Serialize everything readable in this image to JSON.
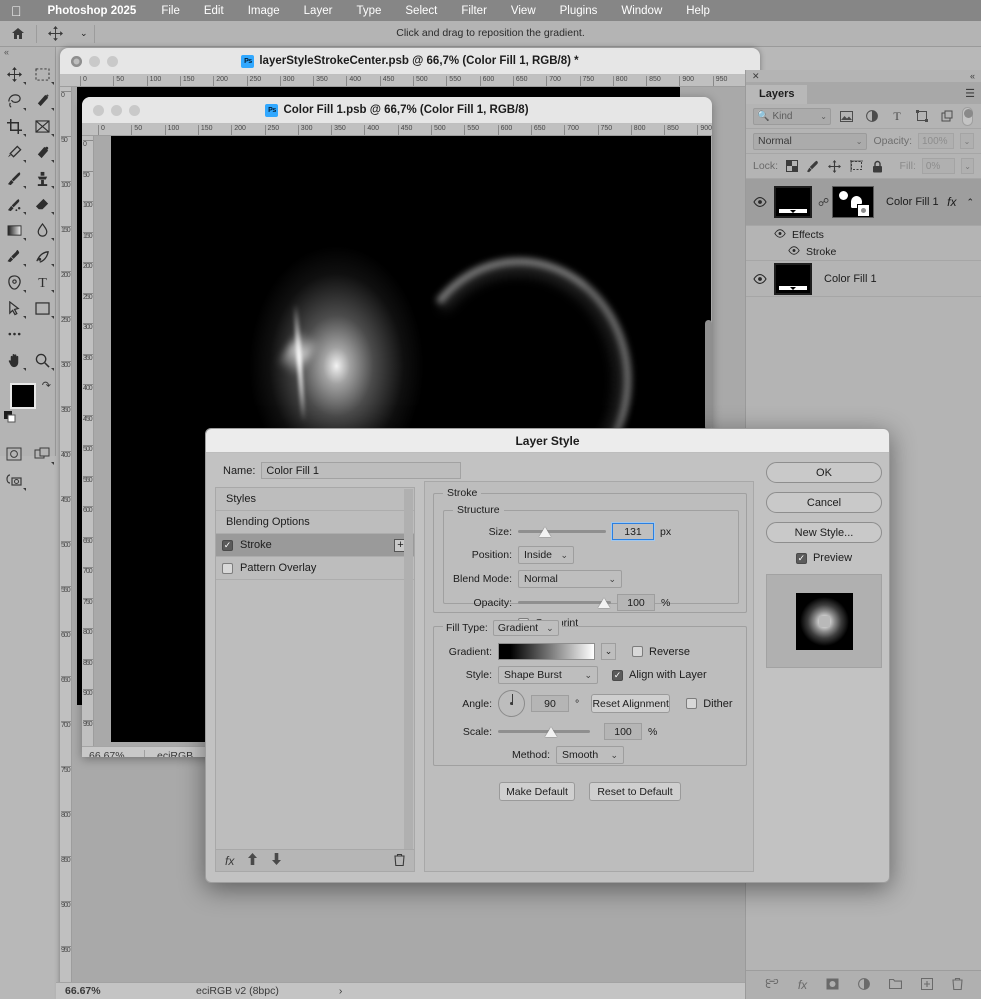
{
  "menubar": {
    "apple_icon": "apple-icon",
    "app_name": "Photoshop 2025",
    "items": [
      "File",
      "Edit",
      "Image",
      "Layer",
      "Type",
      "Select",
      "Filter",
      "View",
      "Plugins",
      "Window",
      "Help"
    ]
  },
  "options_bar": {
    "home_icon": "home-icon",
    "tool_icon": "move-tool-icon",
    "chevron": "⌄",
    "hint": "Click and drag to reposition the gradient."
  },
  "toolbar": {
    "collapse_icon": "collapse-panel-icon",
    "tools": [
      {
        "name": "move-tool"
      },
      {
        "name": "rectangular-marquee-tool"
      },
      {
        "name": "lasso-tool"
      },
      {
        "name": "magic-wand-tool"
      },
      {
        "name": "crop-tool"
      },
      {
        "name": "frame-tool"
      },
      {
        "name": "eyedropper-tool"
      },
      {
        "name": "spot-healing-brush-tool"
      },
      {
        "name": "brush-tool"
      },
      {
        "name": "clone-stamp-tool"
      },
      {
        "name": "history-brush-tool"
      },
      {
        "name": "eraser-tool"
      },
      {
        "name": "gradient-tool"
      },
      {
        "name": "blur-tool"
      },
      {
        "name": "dodge-tool"
      },
      {
        "name": "pen-tool-curvature"
      },
      {
        "name": "pen-tool"
      },
      {
        "name": "type-tool"
      },
      {
        "name": "path-selection-tool"
      },
      {
        "name": "rectangle-tool"
      },
      {
        "name": "more-tools"
      },
      {
        "name": "hand-tool"
      },
      {
        "name": "zoom-tool"
      }
    ],
    "foreground_color": "#000000",
    "background_color": "#ffffff",
    "swap_icon": "swap-colors-icon",
    "default_icon": "default-colors-icon",
    "quickmask_icon": "quick-mask-icon",
    "screenmode_icon": "screen-mode-icon",
    "camera_icon": "share-camera-icon"
  },
  "background_window": {
    "title": "layerStyleStrokeCenter.psb @ 66,7% (Color Fill 1, RGB/8) *",
    "ps_badge": "Ps",
    "traffic_lights": [
      "close",
      "minimize",
      "zoom"
    ]
  },
  "document_window": {
    "title": "Color Fill 1.psb @ 66,7% (Color Fill 1, RGB/8)",
    "ps_badge": "Ps",
    "ruler_h_ticks": [
      "0",
      "50",
      "100",
      "150",
      "200",
      "250",
      "300",
      "350",
      "400",
      "450",
      "500",
      "550",
      "600",
      "650",
      "700",
      "750",
      "800",
      "850",
      "900",
      "950",
      "100"
    ],
    "ruler_v_ticks": [
      "0",
      "50",
      "100",
      "150",
      "200",
      "250",
      "300",
      "350",
      "400",
      "450",
      "500",
      "550",
      "600",
      "650",
      "700",
      "750",
      "800",
      "850",
      "900",
      "950",
      "10"
    ],
    "status": {
      "zoom": "66.67%",
      "profile": "eciRGB"
    }
  },
  "app_status": {
    "zoom": "66.67%",
    "profile": "eciRGB v2 (8bpc)",
    "arrow": "›"
  },
  "layers_panel": {
    "close_icon": "close-panel-icon",
    "collapse_icon": "collapse-panel-icon",
    "tab_label": "Layers",
    "menu_icon": "panel-menu-icon",
    "filter": {
      "search_icon": "search-icon",
      "kind_label": "Kind",
      "chevron": "⌄",
      "icons": [
        "pixel-layer-filter-icon",
        "adjustment-layer-filter-icon",
        "type-layer-filter-icon",
        "shape-layer-filter-icon",
        "smart-object-filter-icon"
      ],
      "toggle": "filter-toggle"
    },
    "blend_mode": "Normal",
    "opacity_label": "Opacity:",
    "opacity_value": "100%",
    "lock_label": "Lock:",
    "lock_icons": [
      "lock-transparency-icon",
      "lock-image-icon",
      "lock-position-icon",
      "lock-artboard-icon",
      "lock-all-icon"
    ],
    "fill_label": "Fill:",
    "fill_value": "0%",
    "layers": [
      {
        "name": "Color Fill 1",
        "visible": true,
        "selected": true,
        "fx": "fx",
        "expand_chevron": "⌃",
        "effects_label": "Effects",
        "effects": [
          "Stroke"
        ]
      },
      {
        "name": "Color Fill 1",
        "visible": true,
        "selected": false
      }
    ],
    "footer_icons": [
      "link-layers-icon",
      "add-layer-style-icon",
      "add-layer-mask-icon",
      "new-adjustment-layer-icon",
      "new-group-icon",
      "new-layer-icon",
      "delete-layer-icon"
    ]
  },
  "dialog": {
    "title": "Layer Style",
    "name_label": "Name:",
    "name_value": "Color Fill 1",
    "styles_list": [
      {
        "label": "Styles",
        "type": "plain"
      },
      {
        "label": "Blending Options",
        "type": "plain"
      },
      {
        "label": "Stroke",
        "type": "check",
        "checked": true,
        "active": true,
        "plus": "+"
      },
      {
        "label": "Pattern Overlay",
        "type": "check",
        "checked": false,
        "active": false
      }
    ],
    "styles_footer_icons": [
      "fx-icon",
      "move-up-icon",
      "move-down-icon",
      "delete-effect-icon"
    ],
    "stroke": {
      "legend": "Stroke",
      "structure_legend": "Structure",
      "size_label": "Size:",
      "size_value": "131",
      "size_unit": "px",
      "size_percent": 30,
      "position_label": "Position:",
      "position_value": "Inside",
      "blend_mode_label": "Blend Mode:",
      "blend_mode_value": "Normal",
      "opacity_label": "Opacity:",
      "opacity_value": "100",
      "opacity_unit": "%",
      "opacity_percent": 100,
      "overprint_label": "Overprint",
      "overprint_checked": false
    },
    "fill": {
      "fill_type_label": "Fill Type:",
      "fill_type_value": "Gradient",
      "gradient_label": "Gradient:",
      "gradient_colors": [
        "#000000",
        "#ffffff"
      ],
      "reverse_label": "Reverse",
      "reverse_checked": false,
      "style_label": "Style:",
      "style_value": "Shape Burst",
      "align_label": "Align with Layer",
      "align_checked": true,
      "angle_label": "Angle:",
      "angle_value": "90",
      "angle_unit": "°",
      "reset_alignment_label": "Reset Alignment",
      "dither_label": "Dither",
      "dither_checked": false,
      "scale_label": "Scale:",
      "scale_value": "100",
      "scale_unit": "%",
      "scale_percent": 51,
      "method_label": "Method:",
      "method_value": "Smooth"
    },
    "make_default_label": "Make Default",
    "reset_default_label": "Reset to Default",
    "buttons": {
      "ok": "OK",
      "cancel": "Cancel",
      "new_style": "New Style..."
    },
    "preview_label": "Preview",
    "preview_checked": true
  }
}
